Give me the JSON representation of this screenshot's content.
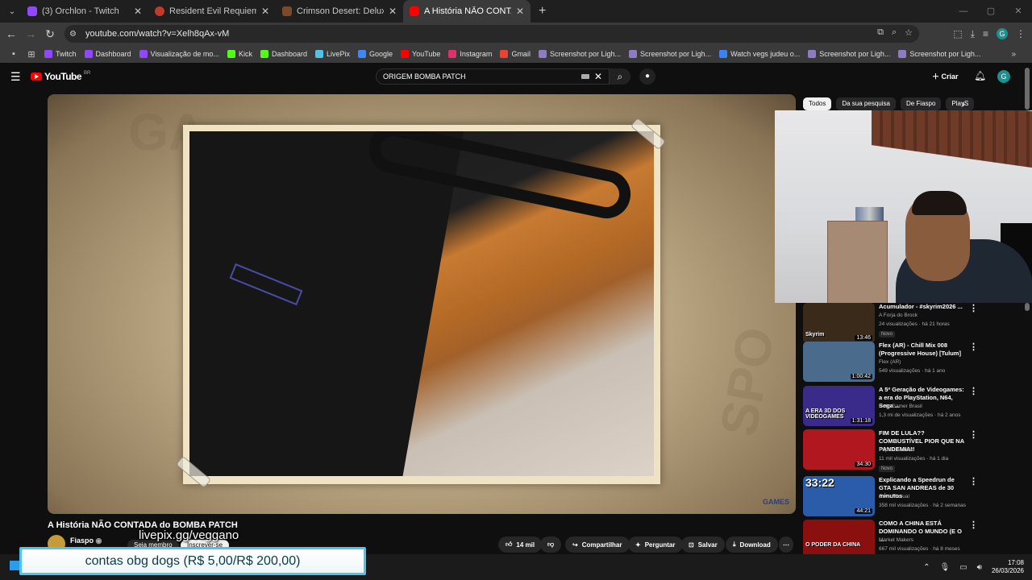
{
  "browser": {
    "tabs": [
      {
        "title": "(3) Orchlon - Twitch",
        "color": "#9146ff"
      },
      {
        "title": "Resident Evil Requiem - Speedrun",
        "color": "#c0392b"
      },
      {
        "title": "Crimson Desert: Deluxe Edition",
        "color": "#7a4a2a"
      },
      {
        "title": "A História NÃO CONTADA do BOMBA PATCH",
        "color": "#ff0000"
      }
    ],
    "url": "youtube.com/watch?v=Xelh8qAx-vM",
    "bookmarks": [
      {
        "label": "Twitch",
        "color": "#9146ff"
      },
      {
        "label": "Dashboard",
        "color": "#9146ff"
      },
      {
        "label": "Visualização de mo...",
        "color": "#9146ff"
      },
      {
        "label": "Kick",
        "color": "#53fc18"
      },
      {
        "label": "Dashboard",
        "color": "#53fc18"
      },
      {
        "label": "LivePix",
        "color": "#4fc3e8"
      },
      {
        "label": "Google",
        "color": "#4285f4"
      },
      {
        "label": "YouTube",
        "color": "#ff0000"
      },
      {
        "label": "Instagram",
        "color": "#e1306c"
      },
      {
        "label": "Gmail",
        "color": "#ea4335"
      },
      {
        "label": "Screenshot por Ligh...",
        "color": "#8e7cc3"
      },
      {
        "label": "Screenshot por Ligh...",
        "color": "#8e7cc3"
      },
      {
        "label": "Watch vegs judeu o...",
        "color": "#3b82f6"
      },
      {
        "label": "Screenshot por Ligh...",
        "color": "#8e7cc3"
      },
      {
        "label": "Screenshot por Ligh...",
        "color": "#8e7cc3"
      }
    ],
    "profile_initial": "G"
  },
  "youtube": {
    "logo_text": "YouTube",
    "logo_region": "BR",
    "search_query": "ORIGEM BOMBA PATCH",
    "create_label": "Criar",
    "avatar_initial": "G",
    "video": {
      "title": "A História NÃO CONTADA do BOMBA PATCH",
      "channel": "Fiaspo",
      "member_label": "Seja membro",
      "subscribe_label": "Inscrever-se",
      "likes": "14 mil",
      "share_label": "Compartilhar",
      "ask_label": "Perguntar",
      "save_label": "Salvar",
      "download_label": "Download",
      "bg_words": [
        "GA",
        "SPO"
      ],
      "corner_logo": "GAMES"
    },
    "chips": [
      "Todos",
      "Da sua pesquisa",
      "De Fiaspo",
      "PlayS"
    ],
    "recommendations": [
      {
        "title": "Acumulador - #skyrim2026 ...",
        "channel": "A Forja do Brock",
        "meta": "24 visualizações · há 21 horas",
        "duration": "13:46",
        "badge": "Novo",
        "thumb_text": "Skyrim",
        "thumb_bg": "#3a2a1a"
      },
      {
        "title": "Flex (AR) - Chill Mix 008 (Progressive House) [Tulum]",
        "channel": "Flex (AR)",
        "meta": "549 visualizações · há 1 ano",
        "duration": "1:00:42",
        "badge": "",
        "thumb_text": "",
        "thumb_bg": "#4a6b8c"
      },
      {
        "title": "A 5ª Geração de Videogames: a era do PlayStation, N64, Sega ...",
        "channel": "RetroGamer Brasil",
        "meta": "1,3 mi de visualizações · há 2 anos",
        "duration": "1:31:18",
        "badge": "",
        "thumb_text": "A ERA 3D DOS VIDEOGAMES",
        "thumb_bg": "#3a2a8a"
      },
      {
        "title": "FIM DE LULA?? COMBUSTÍVEL PIOR QUE NA PANDEMIA!!",
        "channel": "Papo Libertário",
        "meta": "11 mil visualizações · há 1 dia",
        "duration": "34:30",
        "badge": "Novo",
        "thumb_text": "",
        "thumb_bg": "#b0171f"
      },
      {
        "title": "Explicando a Speedrun de GTA SAN ANDREAS de 30 minutos",
        "channel": "Save Manual",
        "meta": "358 mil visualizações · há 2 semanas",
        "duration": "44:21",
        "badge": "",
        "thumb_text": "33:22",
        "thumb_bg": "#2a5caa"
      },
      {
        "title": "COMO A CHINA ESTÁ DOMINANDO O MUNDO (E O ...",
        "channel": "Market Makers",
        "meta": "667 mil visualizações · há 8 meses",
        "duration": "",
        "badge": "",
        "thumb_text": "O PODER DA CHINA",
        "thumb_bg": "#8a1010"
      }
    ]
  },
  "overlay": {
    "livepix_text": "livepix.gg/veggano",
    "donation_text": "contas obg dogs (R$ 5,00/R$ 200,00)"
  },
  "taskbar": {
    "time": "17:08",
    "date": "26/03/2026"
  }
}
